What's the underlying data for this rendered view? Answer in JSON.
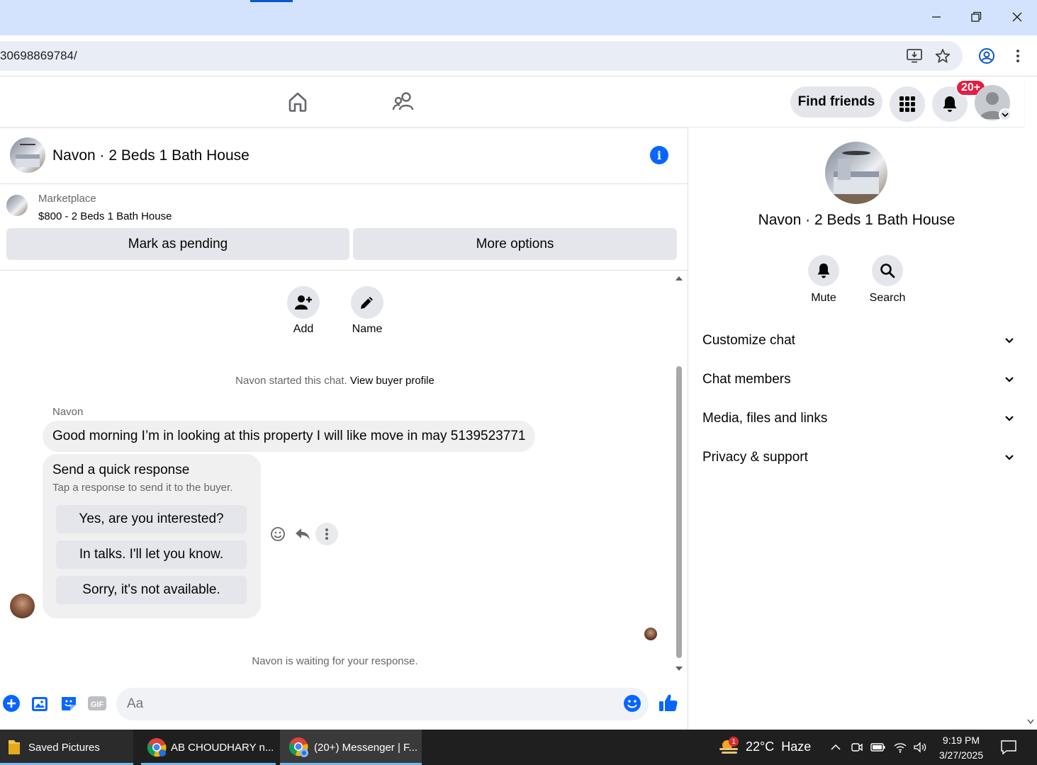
{
  "browser": {
    "url": "30698869784/",
    "window_controls": {
      "minimize": "minimize",
      "restore": "restore",
      "close": "close"
    }
  },
  "fb_nav": {
    "find_friends_label": "Find friends",
    "notification_badge": "20+"
  },
  "chat": {
    "title": "Navon · 2 Beds 1 Bath House",
    "marketplace_label": "Marketplace",
    "listing_text": "$800 - 2 Beds 1 Bath House",
    "mark_pending_label": "Mark as pending",
    "more_options_label": "More options",
    "actions": {
      "add_label": "Add",
      "name_label": "Name"
    },
    "started_text": "Navon started this chat.",
    "view_buyer_profile": "View buyer profile",
    "sender_name": "Navon",
    "message_text": "Good morning I’m in looking at this property I will like move in may 5139523771",
    "quick_response": {
      "title": "Send a quick response",
      "subtitle": "Tap a response to send it to the buyer.",
      "options": [
        "Yes, are you interested?",
        "In talks. I'll let you know.",
        "Sorry, it's not available."
      ]
    },
    "waiting_text": "Navon is waiting for your response.",
    "composer_placeholder": "Aa",
    "gif_label": "GIF"
  },
  "right_panel": {
    "name": "Navon · 2 Beds 1 Bath House",
    "mute_label": "Mute",
    "search_label": "Search",
    "sections": [
      "Customize chat",
      "Chat members",
      "Media, files and links",
      "Privacy & support"
    ]
  },
  "taskbar": {
    "apps": [
      "Saved Pictures",
      "AB CHOUDHARY n...",
      "(20+) Messenger | F..."
    ],
    "weather": "22°C  Haze",
    "weather_badge": "1",
    "time": "9:19 PM",
    "date": "3/27/2025"
  },
  "colors": {
    "accent": "#0866ff",
    "badge": "#e41e3f",
    "taskbar": "#1f1f1f",
    "titlebar": "#d3e3fd"
  }
}
